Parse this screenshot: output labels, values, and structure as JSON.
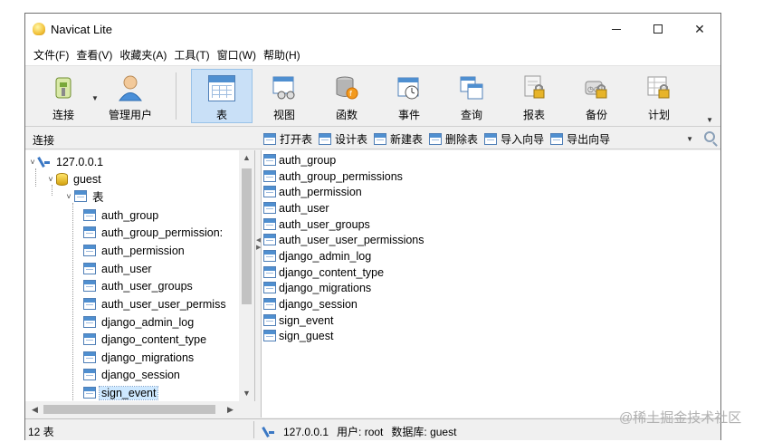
{
  "window": {
    "title": "Navicat Lite"
  },
  "menu": [
    "文件(F)",
    "查看(V)",
    "收藏夹(A)",
    "工具(T)",
    "窗口(W)",
    "帮助(H)"
  ],
  "toolbar": {
    "connect": "连接",
    "manage_users": "管理用户",
    "table": "表",
    "view": "视图",
    "function": "函数",
    "event": "事件",
    "query": "查询",
    "report": "报表",
    "backup": "备份",
    "schedule": "计划"
  },
  "subbar": {
    "label": "连接",
    "actions": [
      "打开表",
      "设计表",
      "新建表",
      "删除表",
      "导入向导",
      "导出向导"
    ]
  },
  "tree": {
    "connection": "127.0.0.1",
    "database": "guest",
    "tables_node": "表",
    "tables": [
      "auth_group",
      "auth_group_permission:",
      "auth_permission",
      "auth_user",
      "auth_user_groups",
      "auth_user_user_permiss",
      "django_admin_log",
      "django_content_type",
      "django_migrations",
      "django_session",
      "sign_event"
    ],
    "selected": "sign_event"
  },
  "object_list": [
    "auth_group",
    "auth_group_permissions",
    "auth_permission",
    "auth_user",
    "auth_user_groups",
    "auth_user_user_permissions",
    "django_admin_log",
    "django_content_type",
    "django_migrations",
    "django_session",
    "sign_event",
    "sign_guest"
  ],
  "status": {
    "count": "12 表",
    "connection": "127.0.0.1",
    "user": "用户: root",
    "database": "数据库: guest"
  },
  "watermark": "@稀土掘金技术社区"
}
